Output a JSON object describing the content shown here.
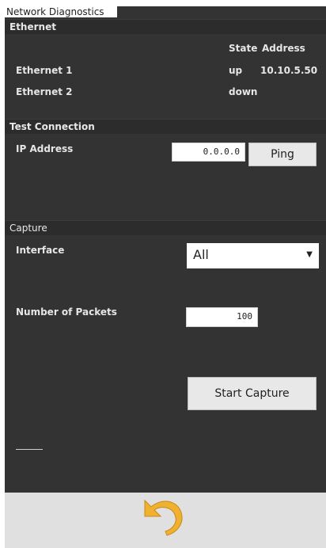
{
  "window": {
    "title": "Network Diagnostics"
  },
  "ethernet": {
    "section_title": "Ethernet",
    "headers": {
      "state": "State",
      "address": "Address"
    },
    "rows": [
      {
        "name": "Ethernet 1",
        "state": "up",
        "address": "10.10.5.50"
      },
      {
        "name": "Ethernet 2",
        "state": "down",
        "address": ""
      }
    ]
  },
  "test": {
    "section_title": "Test Connection",
    "ip_label": "IP Address",
    "ip_value": "0.0.0.0",
    "ping_label": "Ping"
  },
  "capture": {
    "section_title": "Capture",
    "interface_label": "Interface",
    "interface_selected": "All",
    "packets_label": "Number of Packets",
    "packets_value": "100",
    "start_label": "Start Capture"
  },
  "footer": {
    "undo_icon": "undo-arrow-icon",
    "accent": "#f0b030"
  }
}
